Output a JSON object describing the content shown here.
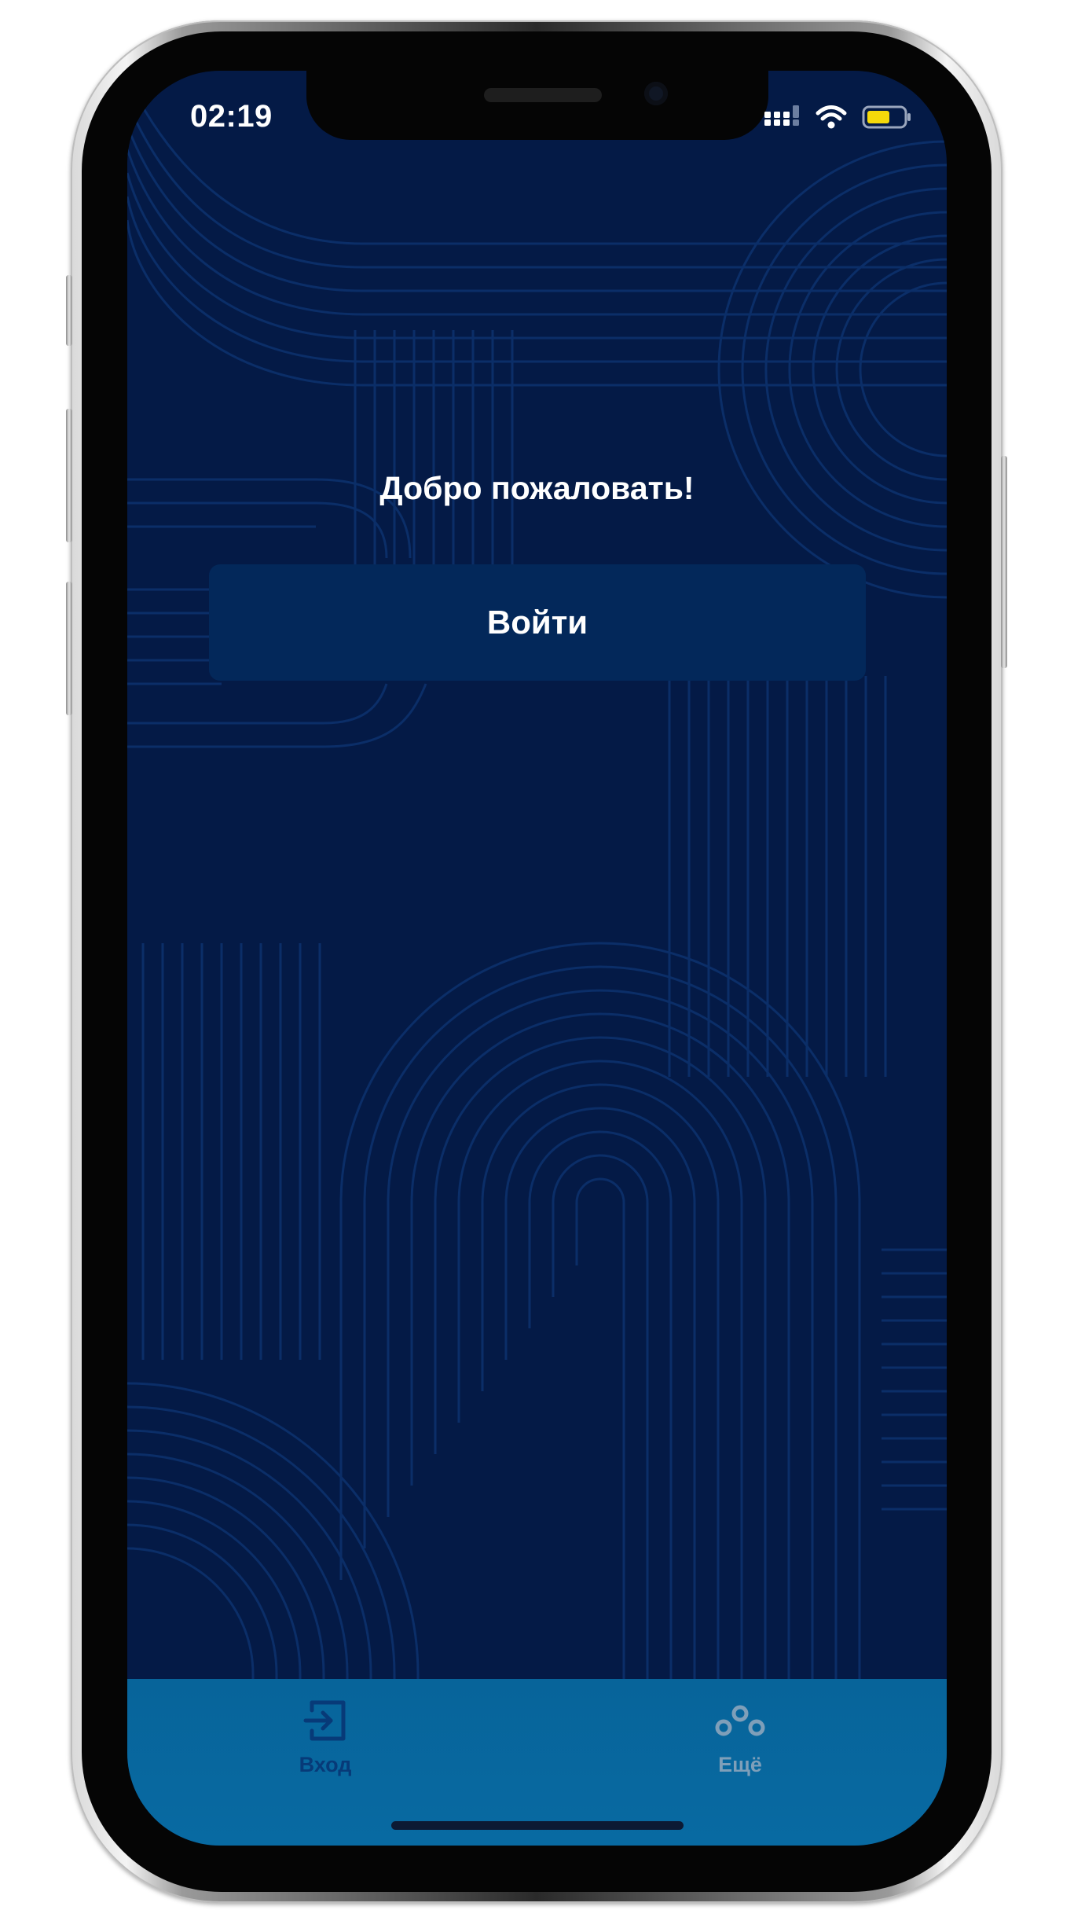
{
  "status_bar": {
    "time": "02:19",
    "icons": [
      "cellular-signal-icon",
      "wifi-icon",
      "battery-icon"
    ],
    "battery_color": "#f5d90a"
  },
  "main": {
    "welcome_text": "Добро пожаловать!",
    "login_button_label": "Войти"
  },
  "tab_bar": {
    "tabs": [
      {
        "label": "Вход",
        "icon": "login-icon",
        "color": "#073a78",
        "selected": true
      },
      {
        "label": "Ещё",
        "icon": "more-icon",
        "color": "#7f9fb9",
        "selected": false
      }
    ]
  },
  "colors": {
    "background": "#041a46",
    "pattern_line": "#0a2c66",
    "button": "#03285a",
    "tab_bar": "#07649a"
  }
}
